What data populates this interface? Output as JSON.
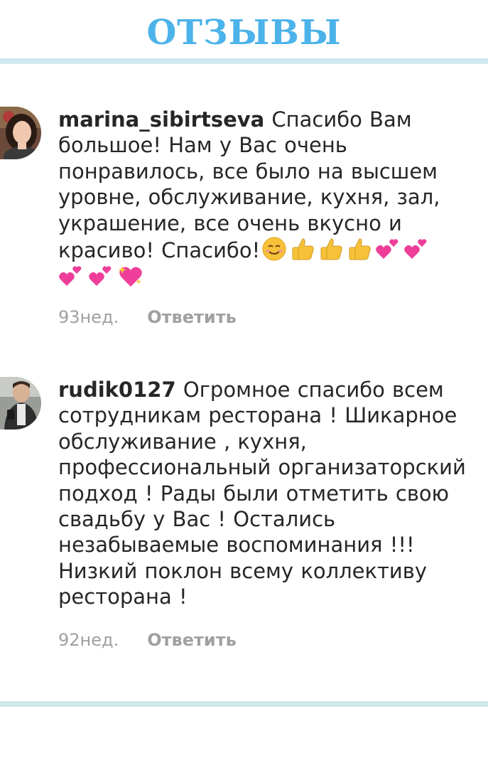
{
  "header": {
    "title": "ОТЗЫВЫ"
  },
  "comments": [
    {
      "username": "marina_sibirtseva",
      "lines": [
        " Спасибо Вам",
        "большое! Нам у Вас очень",
        "понравилось, все было на высшем",
        "уровне, обслуживание, кухня, зал,",
        "украшение, все очень вкусно и",
        "красиво!  Спасибо!"
      ],
      "emojis": [
        "smiling-face",
        "thumbs-up",
        "thumbs-up",
        "thumbs-up",
        "two-hearts",
        "two-hearts",
        "two-hearts",
        "two-hearts",
        "sparkling-heart"
      ],
      "time": "93нед.",
      "reply": "Ответить"
    },
    {
      "username": "rudik0127",
      "lines": [
        " Огромное спасибо всем",
        "сотрудникам ресторана ! Шикарное",
        "обслуживание , кухня,",
        "профессиональный  организаторский",
        "подход ! Рады были отметить  свою",
        "свадьбу у Вас ! Остались",
        "незабываемые  воспоминания !!!",
        "Низкий поклон всему коллективу",
        "ресторана !"
      ],
      "time": "92нед.",
      "reply": "Ответить"
    }
  ],
  "colors": {
    "title": "#4cb3ea",
    "divider": "#cfe8ee",
    "text": "#262626",
    "meta": "#a0a0a0"
  }
}
